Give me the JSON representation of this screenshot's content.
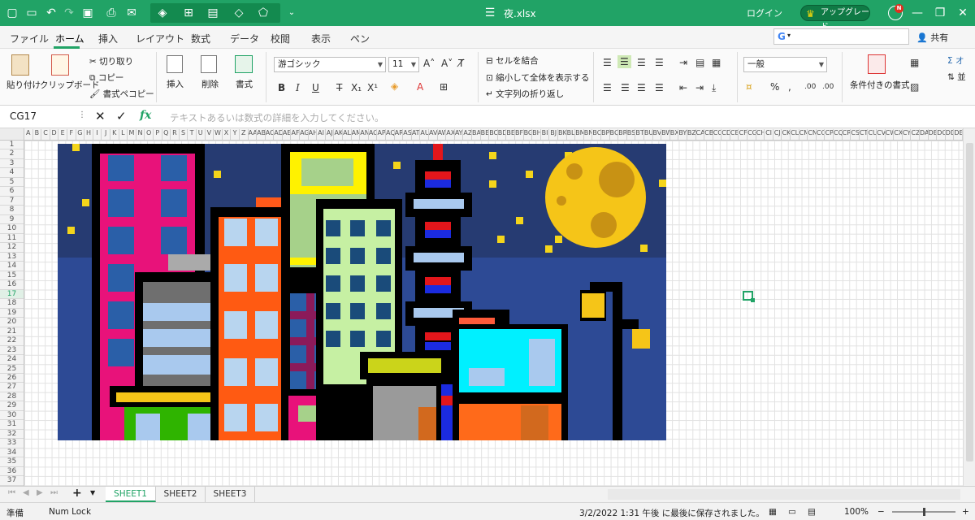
{
  "titlebar": {
    "filename": "夜.xlsx",
    "login": "ログイン",
    "upgrade": "アップグレード",
    "badge": "N"
  },
  "menu": {
    "items": [
      "ファイル",
      "ホーム",
      "挿入",
      "レイアウト",
      "数式",
      "データ",
      "校閲",
      "表示",
      "ペン"
    ],
    "active": "ホーム",
    "search_brand": "G",
    "share": "共有"
  },
  "ribbon": {
    "paste": "貼り付け",
    "clipboard": "クリップボード",
    "cut": "切り取り",
    "copy": "コピー",
    "format_painter": "書式ペコピー",
    "insert": "挿入",
    "delete": "削除",
    "format": "書式",
    "font_name": "游ゴシック",
    "font_size": "11",
    "merge": "セルを結合",
    "shrink": "縮小して全体を表示する",
    "wrap": "文字列の折り返し",
    "number_format": "一般",
    "conditional": "条件付きの書式",
    "autosum_cut": "オ",
    "sort_cut": "並"
  },
  "formula": {
    "cell_ref": "CG17",
    "fx": "fx",
    "placeholder": "テキストあるいは数式の詳細を入力してください。"
  },
  "columns": [
    "A",
    "B",
    "C",
    "D",
    "E",
    "F",
    "G",
    "H",
    "I",
    "J",
    "K",
    "L",
    "M",
    "N",
    "O",
    "P",
    "Q",
    "R",
    "S",
    "T",
    "U",
    "V",
    "W",
    "X",
    "Y",
    "Z",
    "AA",
    "AB",
    "AC",
    "AD",
    "AE",
    "AF",
    "AG",
    "AH",
    "AI",
    "AJ",
    "AK",
    "AL",
    "AM",
    "AN",
    "AO",
    "AP",
    "AQ",
    "AR",
    "AS",
    "AT",
    "AU",
    "AV",
    "AW",
    "AX",
    "AY",
    "AZ",
    "BA",
    "BB",
    "BC",
    "BD",
    "BE",
    "BF",
    "BG",
    "BH",
    "BI",
    "BJ",
    "BK",
    "BL",
    "BM",
    "BN",
    "BO",
    "BP",
    "BQ",
    "BR",
    "BS",
    "BT",
    "BU",
    "BV",
    "BW",
    "BX",
    "BY",
    "BZ",
    "CA",
    "CB",
    "CC",
    "CD",
    "CE",
    "CF",
    "CG",
    "CH",
    "CI",
    "CJ",
    "CK",
    "CL",
    "CM",
    "CN",
    "CO",
    "CP",
    "CQ",
    "CR",
    "CS",
    "CT",
    "CU",
    "CV",
    "CW",
    "CX",
    "CY",
    "CZ",
    "DA",
    "DB",
    "DC",
    "DD",
    "DE"
  ],
  "rows": [
    1,
    2,
    3,
    4,
    5,
    6,
    7,
    8,
    9,
    10,
    11,
    12,
    13,
    14,
    15,
    16,
    17,
    18,
    19,
    20,
    21,
    22,
    23,
    24,
    25,
    26,
    27,
    28,
    29,
    30,
    31,
    32,
    33,
    34,
    35,
    36,
    37
  ],
  "sheets": [
    "SHEET1",
    "SHEET2",
    "SHEET3"
  ],
  "active_sheet": "SHEET1",
  "status": {
    "ready": "準備",
    "numlock": "Num Lock",
    "saved": "3/2/2022 1:31 午後 に最後に保存されました。",
    "zoom": "100%"
  },
  "colors": {
    "accent": "#21a366",
    "sky": "#2a3a6e",
    "moon": "#f5c518"
  }
}
